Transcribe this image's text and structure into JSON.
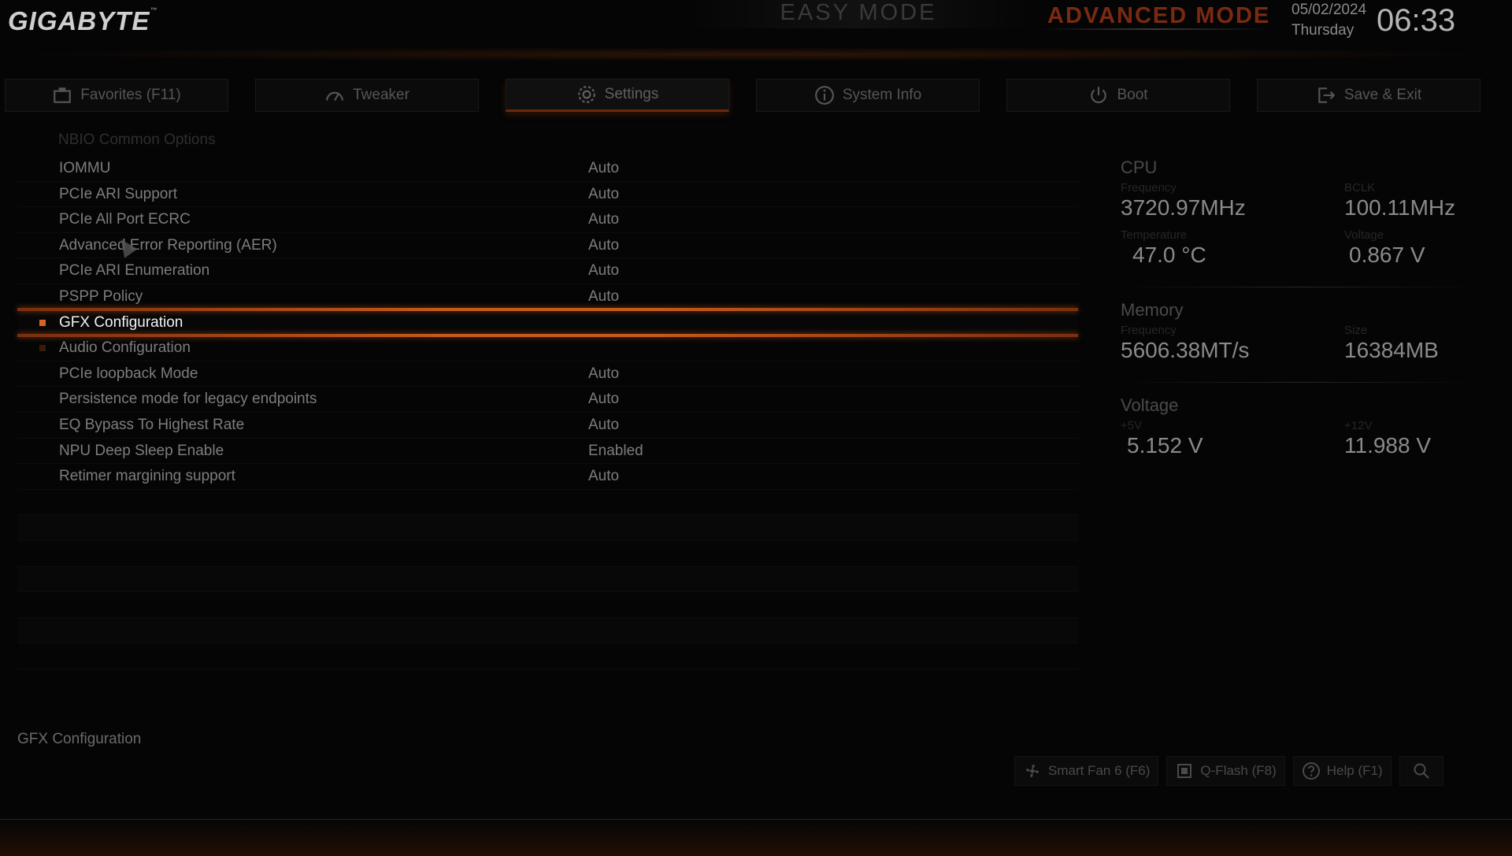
{
  "header": {
    "logo": "GIGABYTE",
    "easy_mode": "EASY MODE",
    "advanced_mode": "ADVANCED MODE",
    "date": "05/02/2024",
    "day": "Thursday",
    "time": "06:33"
  },
  "tabs": [
    {
      "label": "Favorites (F11)",
      "icon": "favorites-icon"
    },
    {
      "label": "Tweaker",
      "icon": "speedometer-icon"
    },
    {
      "label": "Settings",
      "icon": "gear-icon",
      "active": true
    },
    {
      "label": "System Info",
      "icon": "info-icon"
    },
    {
      "label": "Boot",
      "icon": "power-icon"
    },
    {
      "label": "Save & Exit",
      "icon": "exit-icon"
    }
  ],
  "settings": {
    "section_title": "NBIO Common Options",
    "items": [
      {
        "label": "IOMMU",
        "value": "Auto"
      },
      {
        "label": "PCIe ARI Support",
        "value": "Auto"
      },
      {
        "label": "PCIe All Port ECRC",
        "value": "Auto"
      },
      {
        "label": "Advanced Error Reporting (AER)",
        "value": "Auto"
      },
      {
        "label": "PCIe ARI Enumeration",
        "value": "Auto"
      },
      {
        "label": "PSPP Policy",
        "value": "Auto"
      },
      {
        "label": "GFX Configuration",
        "value": "",
        "submenu": true,
        "selected": true
      },
      {
        "label": "Audio Configuration",
        "value": "",
        "submenu": true
      },
      {
        "label": "PCIe loopback Mode",
        "value": "Auto"
      },
      {
        "label": "Persistence mode for legacy endpoints",
        "value": "Auto"
      },
      {
        "label": "EQ Bypass To Highest Rate",
        "value": "Auto"
      },
      {
        "label": "NPU Deep Sleep Enable",
        "value": "Enabled"
      },
      {
        "label": "Retimer margining support",
        "value": "Auto"
      }
    ],
    "help_text": "GFX Configuration"
  },
  "monitor": {
    "cpu": {
      "title": "CPU",
      "frequency_label": "Frequency",
      "frequency": "3720.97MHz",
      "bclk_label": "BCLK",
      "bclk": "100.11MHz",
      "temperature_label": "Temperature",
      "temperature": "47.0 °C",
      "voltage_label": "Voltage",
      "voltage": "0.867 V"
    },
    "memory": {
      "title": "Memory",
      "frequency_label": "Frequency",
      "frequency": "5606.38MT/s",
      "size_label": "Size",
      "size": "16384MB"
    },
    "voltage": {
      "title": "Voltage",
      "v5_label": "+5V",
      "v5": "5.152 V",
      "v12_label": "+12V",
      "v12": "11.988 V"
    }
  },
  "footer": {
    "smart_fan": "Smart Fan 6 (F6)",
    "qflash": "Q-Flash (F8)",
    "help": "Help (F1)"
  },
  "colors": {
    "accent": "#c55a1c",
    "background": "#050505"
  }
}
